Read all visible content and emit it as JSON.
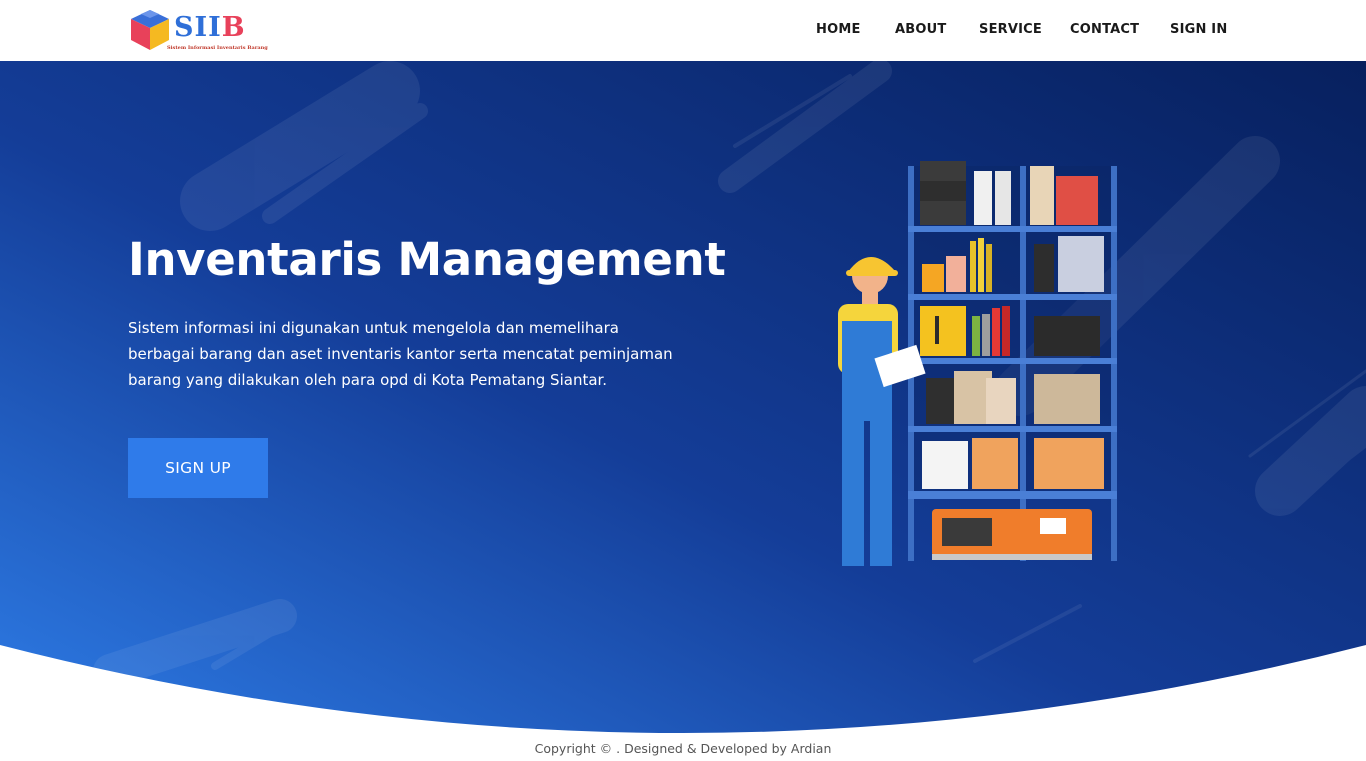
{
  "brand": {
    "name_part1": "SII",
    "name_part2": "B",
    "tagline": "Sistem Informasi Inventaris Barang"
  },
  "nav": {
    "items": [
      {
        "label": "HOME"
      },
      {
        "label": "ABOUT"
      },
      {
        "label": "SERVICE"
      },
      {
        "label": "CONTACT"
      },
      {
        "label": "SIGN IN"
      }
    ]
  },
  "hero": {
    "title": "Inventaris Management",
    "description": "Sistem informasi ini digunakan untuk mengelola dan memelihara berbagai barang dan aset inventaris kantor serta mencatat peminjaman barang yang dilakukan oleh para opd di Kota Pematang Siantar.",
    "cta_label": "SIGN UP",
    "illustration_icon": "warehouse-worker-shelf-illustration"
  },
  "footer": {
    "copyright": "Copyright © . Designed & Developed by Ardian"
  },
  "colors": {
    "hero_gradient_start": "#2f7fea",
    "hero_gradient_end": "#0a1f5c",
    "button": "#2f7bea",
    "brand_blue": "#2f6fd8",
    "brand_red": "#e8415a"
  }
}
